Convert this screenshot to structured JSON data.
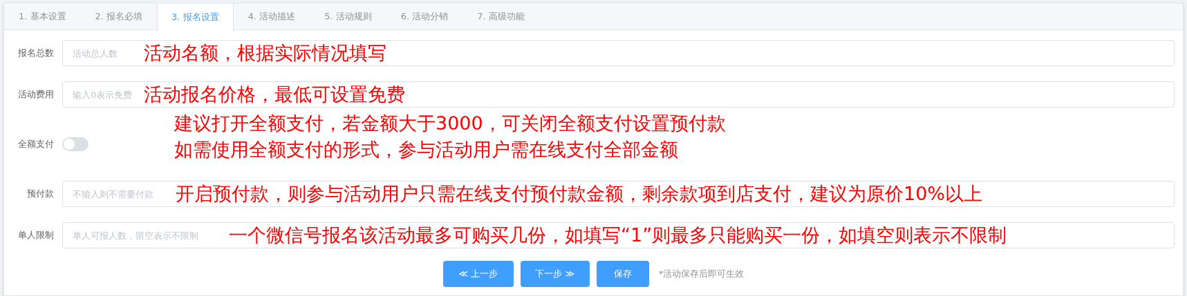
{
  "tabs": [
    {
      "label": "1. 基本设置",
      "selected": false
    },
    {
      "label": "2. 报名必填",
      "selected": false
    },
    {
      "label": "3. 报名设置",
      "selected": true
    },
    {
      "label": "4. 活动描述",
      "selected": false
    },
    {
      "label": "5. 活动规则",
      "selected": false
    },
    {
      "label": "6. 活动分销",
      "selected": false
    },
    {
      "label": "7. 高级功能",
      "selected": false
    }
  ],
  "form": [
    {
      "kind": "input",
      "label": "报名总数",
      "placeholder": "活动总人数",
      "notes": [
        "活动名额，根据实际情况填写"
      ]
    },
    {
      "kind": "input",
      "label": "活动费用",
      "placeholder": "输入0表示免费",
      "notes": [
        "活动报名价格，最低可设置免费"
      ]
    },
    {
      "kind": "toggle",
      "label": "全额支付",
      "on": false,
      "notes": [
        "建议打开全额支付，若金额大于3000，可关闭全额支付设置预付款",
        "如需使用全额支付的形式，参与活动用户需在线支付全部金额"
      ]
    },
    {
      "kind": "input",
      "label": "预付款",
      "placeholder": "不输入则不需要付款",
      "notes": [
        "开启预付款，则参与活动用户只需在线支付预付款金额，剩余款项到店支付，建议为原价10%以上"
      ]
    },
    {
      "kind": "input",
      "label": "单人限制",
      "placeholder": "单人可报人数，留空表示不限制",
      "notes": [
        "一个微信号报名该活动最多可购买几份，如填写“1”则最多只能购买一份，如填空则表示不限制"
      ]
    }
  ],
  "buttons": [
    {
      "kind": "prev",
      "label": "≪ 上一步"
    },
    {
      "kind": "next",
      "label": "下一步 ≫"
    },
    {
      "kind": "save",
      "label": "保存"
    }
  ],
  "hint": "*活动保存后即可生效"
}
